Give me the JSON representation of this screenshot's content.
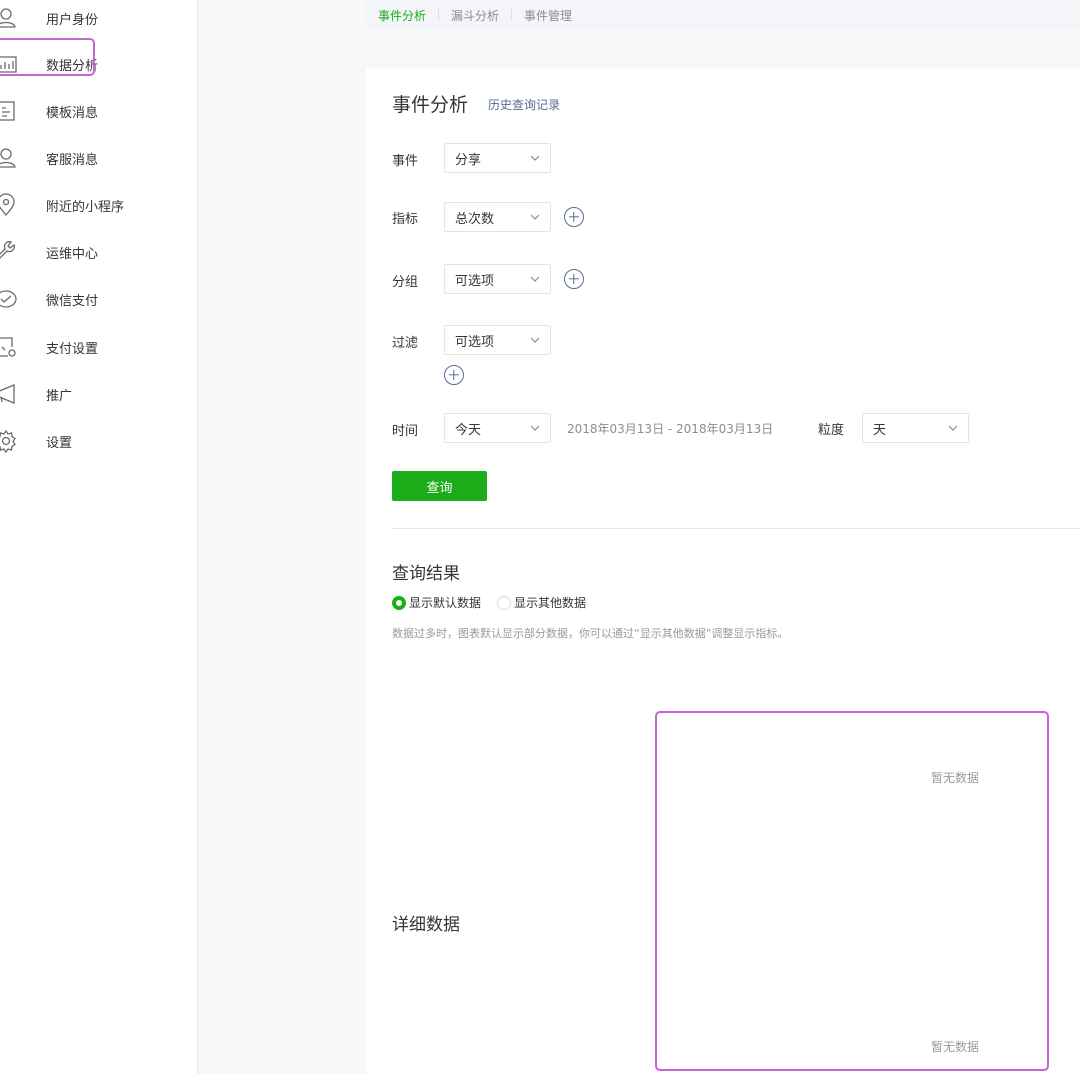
{
  "sidebar": {
    "items": [
      {
        "label": "用户身份",
        "icon": "user-icon"
      },
      {
        "label": "数据分析",
        "icon": "bar-chart-icon"
      },
      {
        "label": "模板消息",
        "icon": "template-icon"
      },
      {
        "label": "客服消息",
        "icon": "customer-service-icon"
      },
      {
        "label": "附近的小程序",
        "icon": "location-icon"
      },
      {
        "label": "运维中心",
        "icon": "wrench-icon"
      },
      {
        "label": "微信支付",
        "icon": "wechat-pay-icon"
      },
      {
        "label": "支付设置",
        "icon": "payment-settings-icon"
      },
      {
        "label": "推广",
        "icon": "megaphone-icon"
      },
      {
        "label": "设置",
        "icon": "gear-icon"
      }
    ]
  },
  "tabs": [
    {
      "label": "事件分析",
      "active": true
    },
    {
      "label": "漏斗分析",
      "active": false
    },
    {
      "label": "事件管理",
      "active": false
    }
  ],
  "panel": {
    "title": "事件分析",
    "history_link": "历史查询记录",
    "fields": {
      "event": {
        "label": "事件",
        "value": "分享"
      },
      "metric": {
        "label": "指标",
        "value": "总次数"
      },
      "group": {
        "label": "分组",
        "value": "可选项"
      },
      "filter": {
        "label": "过滤",
        "value": "可选项"
      },
      "time": {
        "label": "时间",
        "value": "今天",
        "range": "2018年03月13日 - 2018年03月13日"
      },
      "granularity": {
        "label": "粒度",
        "value": "天"
      }
    },
    "query_button": "查询"
  },
  "results": {
    "title": "查询结果",
    "radio_default": "显示默认数据",
    "radio_other": "显示其他数据",
    "hint": "数据过多时，图表默认显示部分数据，你可以通过“显示其他数据”调整显示指标。",
    "empty_chart": "暂无数据"
  },
  "details": {
    "title": "详细数据",
    "empty_table": "暂无数据"
  },
  "colors": {
    "accent_green": "#1aad19",
    "link_blue": "#576b95",
    "highlight_purple": "#c465d3"
  }
}
